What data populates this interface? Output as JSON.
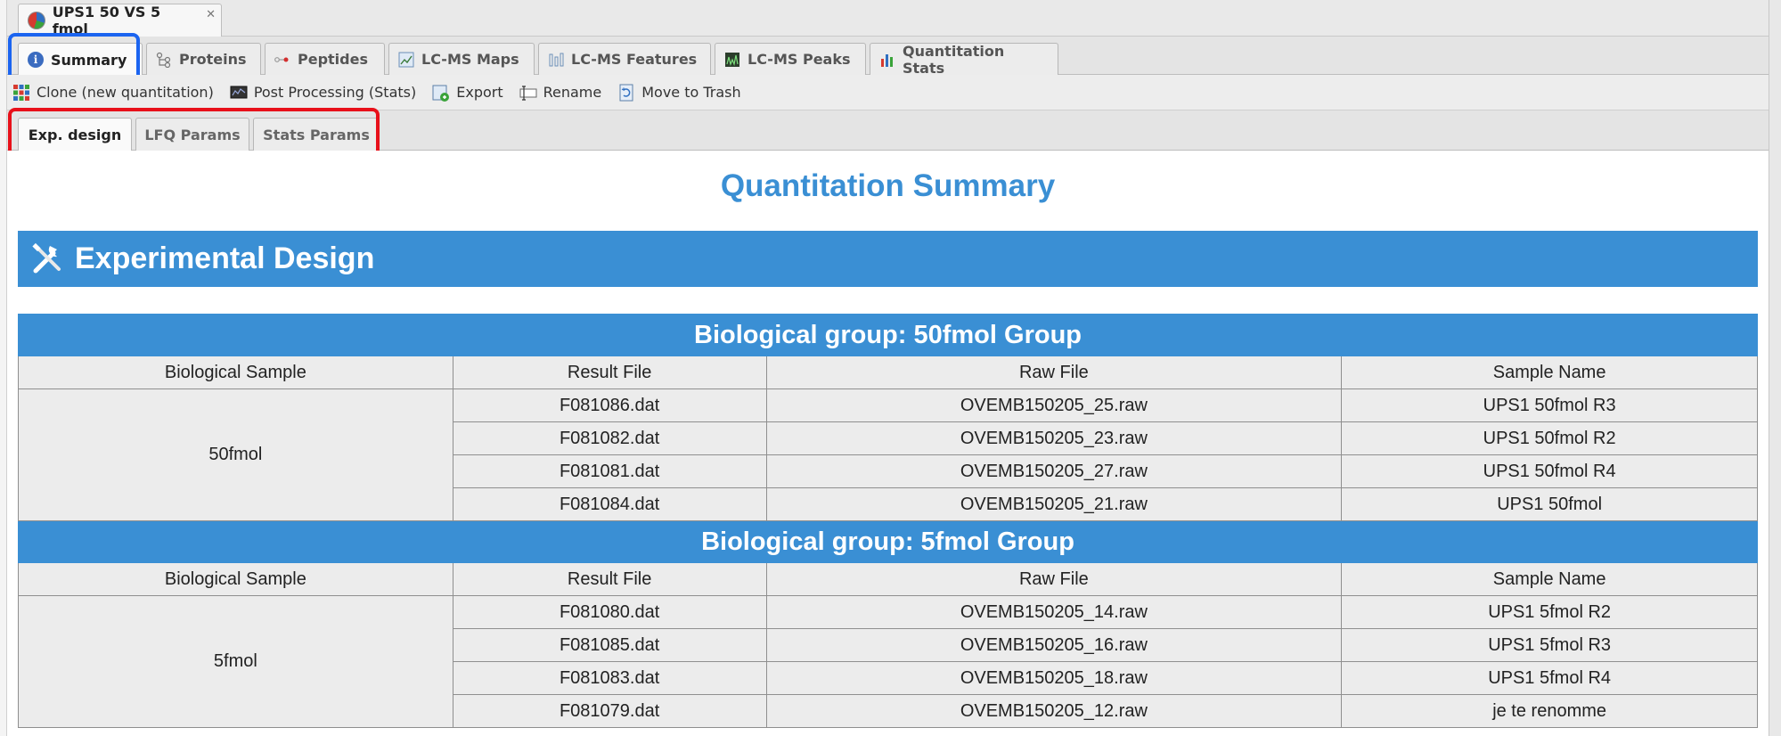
{
  "document_tab": {
    "title": "UPS1 50 VS 5 fmol",
    "close": "✕"
  },
  "main_tabs": [
    {
      "label": "Summary"
    },
    {
      "label": "Proteins"
    },
    {
      "label": "Peptides"
    },
    {
      "label": "LC-MS Maps"
    },
    {
      "label": "LC-MS Features"
    },
    {
      "label": "LC-MS Peaks"
    },
    {
      "label": "Quantitation Stats"
    }
  ],
  "toolbar": [
    {
      "label": "Clone (new quantitation)",
      "icon": "grid-icon"
    },
    {
      "label": "Post Processing (Stats)",
      "icon": "monitor-icon"
    },
    {
      "label": "Export",
      "icon": "export-icon"
    },
    {
      "label": "Rename",
      "icon": "rename-icon"
    },
    {
      "label": "Move to Trash",
      "icon": "trash-icon"
    }
  ],
  "sub_tabs": [
    {
      "label": "Exp. design"
    },
    {
      "label": "LFQ Params"
    },
    {
      "label": "Stats Params"
    }
  ],
  "content": {
    "title": "Quantitation Summary",
    "section": "Experimental Design",
    "headers": [
      "Biological Sample",
      "Result File",
      "Raw File",
      "Sample Name"
    ],
    "groups": [
      {
        "title": "Biological group: 50fmol Group",
        "sample": "50fmol",
        "rows": [
          [
            "F081086.dat",
            "OVEMB150205_25.raw",
            "UPS1 50fmol R3"
          ],
          [
            "F081082.dat",
            "OVEMB150205_23.raw",
            "UPS1 50fmol R2"
          ],
          [
            "F081081.dat",
            "OVEMB150205_27.raw",
            "UPS1 50fmol R4"
          ],
          [
            "F081084.dat",
            "OVEMB150205_21.raw",
            "UPS1 50fmol"
          ]
        ]
      },
      {
        "title": "Biological group: 5fmol Group",
        "sample": "5fmol",
        "rows": [
          [
            "F081080.dat",
            "OVEMB150205_14.raw",
            "UPS1 5fmol R2"
          ],
          [
            "F081085.dat",
            "OVEMB150205_16.raw",
            "UPS1 5fmol R3"
          ],
          [
            "F081083.dat",
            "OVEMB150205_18.raw",
            "UPS1 5fmol R4"
          ],
          [
            "F081079.dat",
            "OVEMB150205_12.raw",
            "je te renomme"
          ]
        ]
      }
    ]
  },
  "colors": {
    "accent": "#3a8fd4",
    "highlight_blue": "#1b64f0",
    "highlight_red": "#e8101a"
  }
}
